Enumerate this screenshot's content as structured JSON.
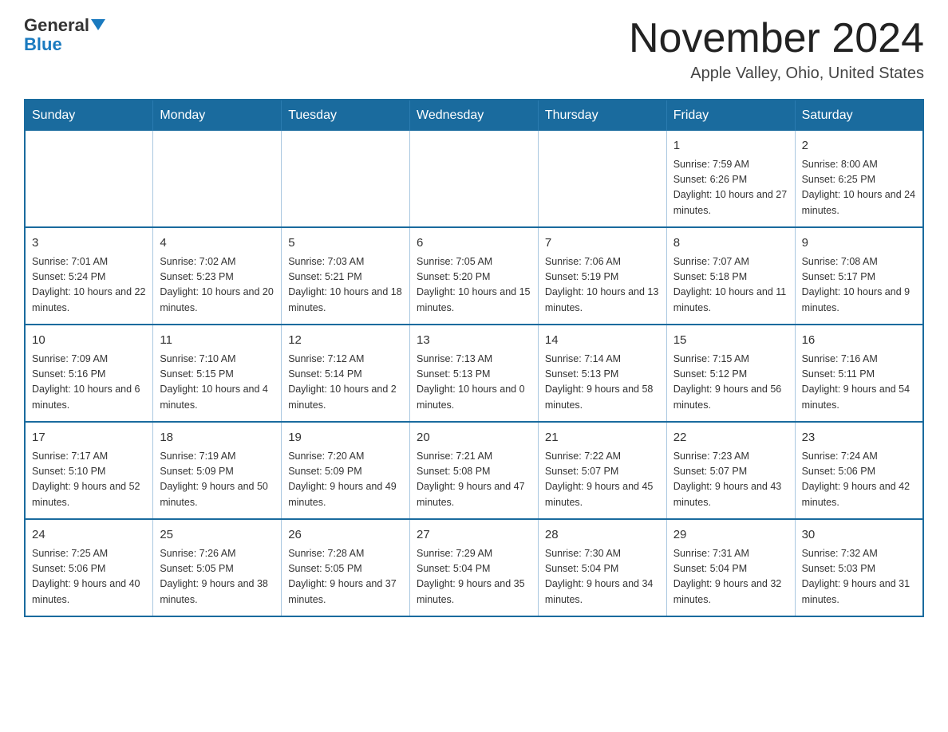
{
  "header": {
    "logo_general": "General",
    "logo_blue": "Blue",
    "month_title": "November 2024",
    "location": "Apple Valley, Ohio, United States"
  },
  "days_of_week": [
    "Sunday",
    "Monday",
    "Tuesday",
    "Wednesday",
    "Thursday",
    "Friday",
    "Saturday"
  ],
  "weeks": [
    [
      {
        "day": "",
        "info": ""
      },
      {
        "day": "",
        "info": ""
      },
      {
        "day": "",
        "info": ""
      },
      {
        "day": "",
        "info": ""
      },
      {
        "day": "",
        "info": ""
      },
      {
        "day": "1",
        "info": "Sunrise: 7:59 AM\nSunset: 6:26 PM\nDaylight: 10 hours and 27 minutes."
      },
      {
        "day": "2",
        "info": "Sunrise: 8:00 AM\nSunset: 6:25 PM\nDaylight: 10 hours and 24 minutes."
      }
    ],
    [
      {
        "day": "3",
        "info": "Sunrise: 7:01 AM\nSunset: 5:24 PM\nDaylight: 10 hours and 22 minutes."
      },
      {
        "day": "4",
        "info": "Sunrise: 7:02 AM\nSunset: 5:23 PM\nDaylight: 10 hours and 20 minutes."
      },
      {
        "day": "5",
        "info": "Sunrise: 7:03 AM\nSunset: 5:21 PM\nDaylight: 10 hours and 18 minutes."
      },
      {
        "day": "6",
        "info": "Sunrise: 7:05 AM\nSunset: 5:20 PM\nDaylight: 10 hours and 15 minutes."
      },
      {
        "day": "7",
        "info": "Sunrise: 7:06 AM\nSunset: 5:19 PM\nDaylight: 10 hours and 13 minutes."
      },
      {
        "day": "8",
        "info": "Sunrise: 7:07 AM\nSunset: 5:18 PM\nDaylight: 10 hours and 11 minutes."
      },
      {
        "day": "9",
        "info": "Sunrise: 7:08 AM\nSunset: 5:17 PM\nDaylight: 10 hours and 9 minutes."
      }
    ],
    [
      {
        "day": "10",
        "info": "Sunrise: 7:09 AM\nSunset: 5:16 PM\nDaylight: 10 hours and 6 minutes."
      },
      {
        "day": "11",
        "info": "Sunrise: 7:10 AM\nSunset: 5:15 PM\nDaylight: 10 hours and 4 minutes."
      },
      {
        "day": "12",
        "info": "Sunrise: 7:12 AM\nSunset: 5:14 PM\nDaylight: 10 hours and 2 minutes."
      },
      {
        "day": "13",
        "info": "Sunrise: 7:13 AM\nSunset: 5:13 PM\nDaylight: 10 hours and 0 minutes."
      },
      {
        "day": "14",
        "info": "Sunrise: 7:14 AM\nSunset: 5:13 PM\nDaylight: 9 hours and 58 minutes."
      },
      {
        "day": "15",
        "info": "Sunrise: 7:15 AM\nSunset: 5:12 PM\nDaylight: 9 hours and 56 minutes."
      },
      {
        "day": "16",
        "info": "Sunrise: 7:16 AM\nSunset: 5:11 PM\nDaylight: 9 hours and 54 minutes."
      }
    ],
    [
      {
        "day": "17",
        "info": "Sunrise: 7:17 AM\nSunset: 5:10 PM\nDaylight: 9 hours and 52 minutes."
      },
      {
        "day": "18",
        "info": "Sunrise: 7:19 AM\nSunset: 5:09 PM\nDaylight: 9 hours and 50 minutes."
      },
      {
        "day": "19",
        "info": "Sunrise: 7:20 AM\nSunset: 5:09 PM\nDaylight: 9 hours and 49 minutes."
      },
      {
        "day": "20",
        "info": "Sunrise: 7:21 AM\nSunset: 5:08 PM\nDaylight: 9 hours and 47 minutes."
      },
      {
        "day": "21",
        "info": "Sunrise: 7:22 AM\nSunset: 5:07 PM\nDaylight: 9 hours and 45 minutes."
      },
      {
        "day": "22",
        "info": "Sunrise: 7:23 AM\nSunset: 5:07 PM\nDaylight: 9 hours and 43 minutes."
      },
      {
        "day": "23",
        "info": "Sunrise: 7:24 AM\nSunset: 5:06 PM\nDaylight: 9 hours and 42 minutes."
      }
    ],
    [
      {
        "day": "24",
        "info": "Sunrise: 7:25 AM\nSunset: 5:06 PM\nDaylight: 9 hours and 40 minutes."
      },
      {
        "day": "25",
        "info": "Sunrise: 7:26 AM\nSunset: 5:05 PM\nDaylight: 9 hours and 38 minutes."
      },
      {
        "day": "26",
        "info": "Sunrise: 7:28 AM\nSunset: 5:05 PM\nDaylight: 9 hours and 37 minutes."
      },
      {
        "day": "27",
        "info": "Sunrise: 7:29 AM\nSunset: 5:04 PM\nDaylight: 9 hours and 35 minutes."
      },
      {
        "day": "28",
        "info": "Sunrise: 7:30 AM\nSunset: 5:04 PM\nDaylight: 9 hours and 34 minutes."
      },
      {
        "day": "29",
        "info": "Sunrise: 7:31 AM\nSunset: 5:04 PM\nDaylight: 9 hours and 32 minutes."
      },
      {
        "day": "30",
        "info": "Sunrise: 7:32 AM\nSunset: 5:03 PM\nDaylight: 9 hours and 31 minutes."
      }
    ]
  ]
}
